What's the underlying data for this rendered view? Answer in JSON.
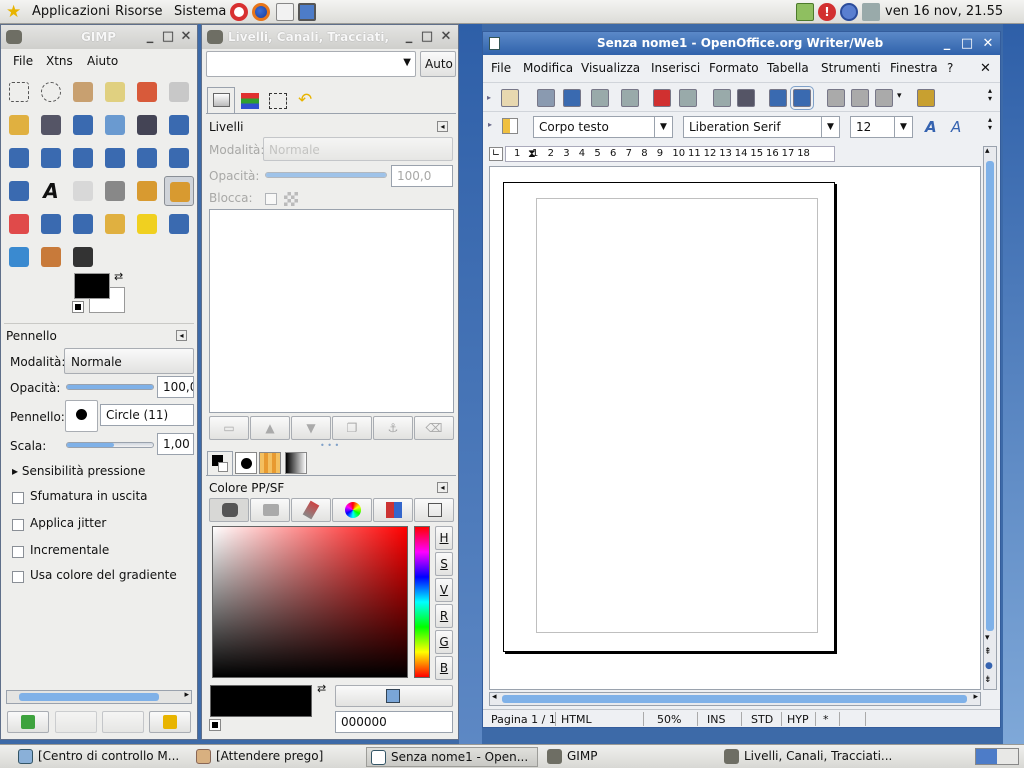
{
  "top_panel": {
    "menus": [
      "Applicazioni",
      "Risorse",
      "Sistema"
    ],
    "clock": "ven 16 nov, 21.55",
    "launcher_icons": [
      "lifebuoy-icon",
      "firefox-icon",
      "mail-icon",
      "monitor-icon"
    ],
    "tray_icons": [
      "network-icon",
      "update-icon",
      "alert-icon",
      "wifi-icon",
      "volume-icon"
    ]
  },
  "gimp_toolbox": {
    "title": "GIMP",
    "menu": [
      "File",
      "Xtns",
      "Aiuto"
    ],
    "tool_options": {
      "header": "Pennello",
      "mode_label": "Modalità:",
      "mode_value": "Normale",
      "opacity_label": "Opacità:",
      "opacity_value": "100,0",
      "opacity_fraction": 1.0,
      "brush_label": "Pennello:",
      "brush_value": "Circle (11)",
      "scale_label": "Scala:",
      "scale_value": "1,00",
      "pressure_label": "Sensibilità pressione",
      "checkboxes": [
        "Sfumatura in uscita",
        "Applica jitter",
        "Incrementale",
        "Usa colore del gradiente"
      ]
    }
  },
  "layers_dock": {
    "title": "Livelli, Canali, Tracciati,",
    "auto_label": "Auto",
    "layers_header": "Livelli",
    "mode_label": "Modalità:",
    "mode_value": "Normale",
    "opacity_label": "Opacità:",
    "opacity_value": "100,0",
    "lock_label": "Blocca:",
    "color_header": "Colore PP/SF",
    "channel_buttons": [
      "H",
      "S",
      "V",
      "R",
      "G",
      "B"
    ],
    "hex_value": "000000"
  },
  "writer": {
    "title": "Senza nome1 - OpenOffice.org Writer/Web",
    "menu": [
      "File",
      "Modifica",
      "Visualizza",
      "Inserisci",
      "Formato",
      "Tabella",
      "Strumenti",
      "Finestra",
      "?"
    ],
    "style_value": "Corpo testo",
    "font_value": "Liberation Serif",
    "size_value": "12",
    "ruler_numbers": [
      "1",
      "1",
      "2",
      "3",
      "4",
      "5",
      "6",
      "7",
      "8",
      "9",
      "10",
      "11",
      "12",
      "13",
      "14",
      "15",
      "16",
      "17",
      "18"
    ],
    "status": {
      "page": "Pagina 1 / 1",
      "mode": "HTML",
      "zoom": "50%",
      "ins": "INS",
      "std": "STD",
      "hyp": "HYP",
      "modified": "*"
    }
  },
  "taskbar": {
    "tasks": [
      "[Centro di controllo M...",
      "[Attendere prego]",
      "Senza nome1 - Open...",
      "GIMP",
      "Livelli, Canali, Tracciati..."
    ]
  },
  "colors": {
    "titlebar_active": "#3b6db5",
    "foreground": "#000000",
    "background": "#ffffff",
    "desktop": "#3d6aa8"
  }
}
